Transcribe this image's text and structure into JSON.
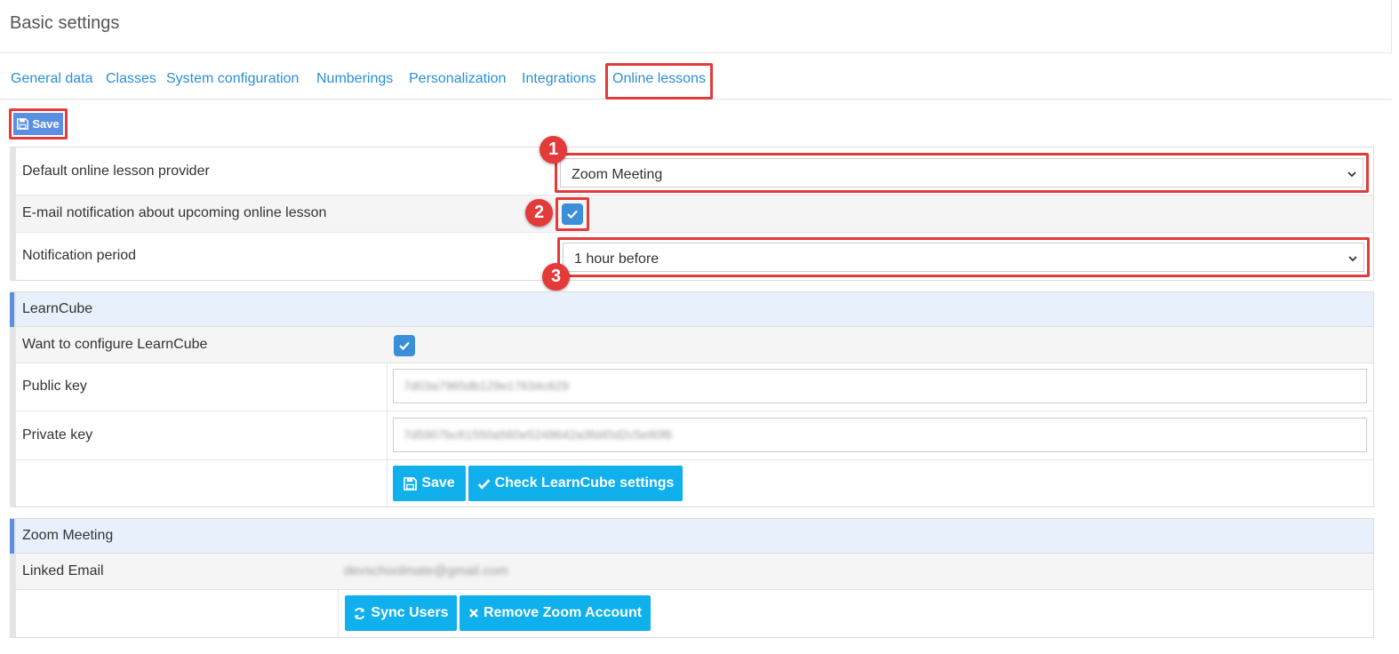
{
  "page": {
    "title": "Basic settings"
  },
  "tabs": [
    {
      "label": "General data"
    },
    {
      "label": "Classes"
    },
    {
      "label": "System configuration"
    },
    {
      "label": "Numberings"
    },
    {
      "label": "Personalization"
    },
    {
      "label": "Integrations"
    },
    {
      "label": "Online lessons",
      "active": true
    }
  ],
  "toolbar": {
    "save_label": "Save"
  },
  "general": {
    "provider_label": "Default online lesson provider",
    "provider_value": "Zoom Meeting",
    "email_notification_label": "E-mail notification about upcoming online lesson",
    "email_notification_checked": true,
    "period_label": "Notification period",
    "period_value": "1 hour before"
  },
  "annotations": [
    "1",
    "2",
    "3"
  ],
  "learncube": {
    "title": "LearnCube",
    "configure_label": "Want to configure LearnCube",
    "configure_checked": true,
    "public_key_label": "Public key",
    "public_key_value": "7d03a7965db129e17634c629",
    "private_key_label": "Private key",
    "private_key_value": "7d5907bc61550a560e5248642a3fd45d2c5e80f6",
    "save_label": "Save",
    "check_label": "Check LearnCube settings"
  },
  "zoom": {
    "title": "Zoom Meeting",
    "email_label": "Linked Email",
    "email_value": "devschoolmate@gmail.com",
    "sync_label": "Sync Users",
    "remove_label": "Remove Zoom Account"
  },
  "colors": {
    "accent": "#2a8fd6",
    "button": "#0fb0ec",
    "highlight": "#e33a3a",
    "checkbox": "#3a8fd8"
  }
}
